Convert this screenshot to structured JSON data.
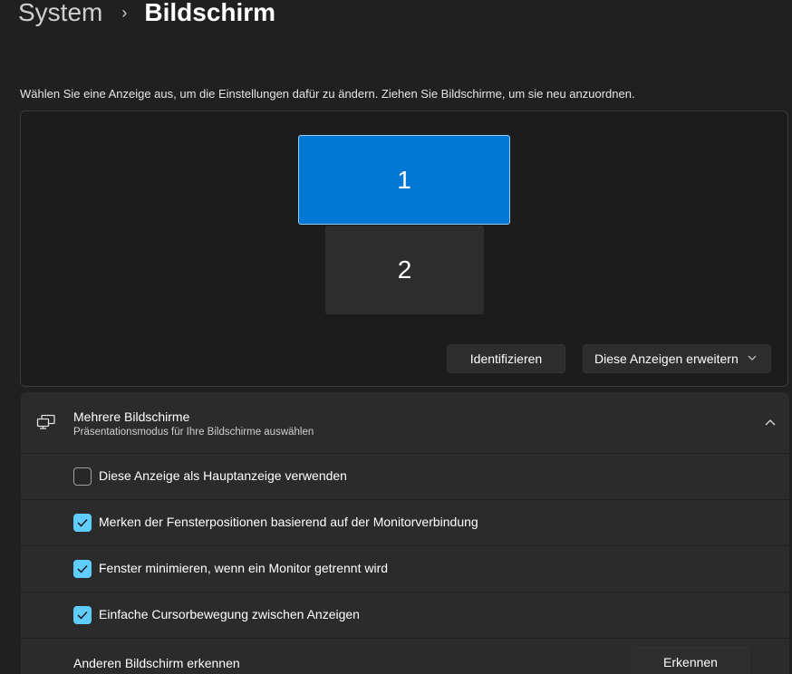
{
  "breadcrumb": {
    "parent": "System",
    "separator": "›",
    "current": "Bildschirm"
  },
  "instruction": "Wählen Sie eine Anzeige aus, um die Einstellungen dafür zu ändern. Ziehen Sie Bildschirme, um sie neu anzuordnen.",
  "arrangement": {
    "monitors": [
      {
        "label": "1",
        "selected": true
      },
      {
        "label": "2",
        "selected": false
      }
    ],
    "identify_label": "Identifizieren",
    "mode_dropdown": {
      "selected": "Diese Anzeigen erweitern"
    }
  },
  "multi_display": {
    "title": "Mehrere Bildschirme",
    "subtitle": "Präsentationsmodus für Ihre Bildschirme auswählen",
    "icon": "multi-monitor-icon",
    "options": [
      {
        "label": "Diese Anzeige als Hauptanzeige verwenden",
        "checked": false
      },
      {
        "label": "Merken der Fensterpositionen basierend auf der Monitorverbindung",
        "checked": true
      },
      {
        "label": "Fenster minimieren, wenn ein Monitor getrennt wird",
        "checked": true
      },
      {
        "label": "Einfache Cursorbewegung zwischen Anzeigen",
        "checked": true
      }
    ],
    "detect": {
      "label": "Anderen Bildschirm erkennen",
      "button": "Erkennen"
    }
  },
  "colors": {
    "accent": "#0078d4",
    "checkbox_accent": "#60cdff",
    "background": "#202020",
    "card": "#2b2b2b"
  }
}
